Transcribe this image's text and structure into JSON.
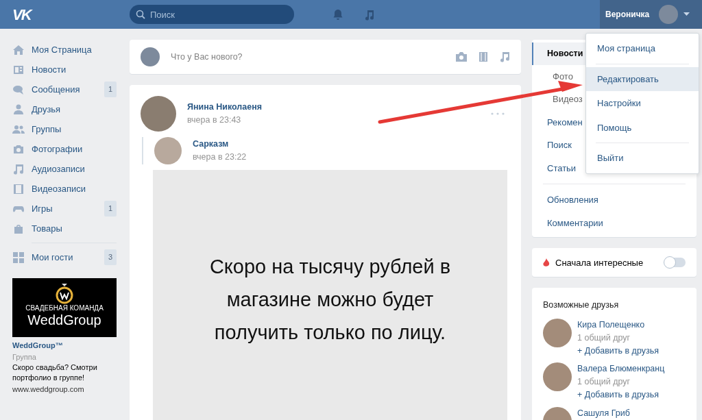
{
  "header": {
    "logo": "VK",
    "search_placeholder": "Поиск",
    "user_name": "Вероничка"
  },
  "sidebar": {
    "items": [
      {
        "label": "Моя Страница"
      },
      {
        "label": "Новости"
      },
      {
        "label": "Сообщения",
        "badge": "1"
      },
      {
        "label": "Друзья"
      },
      {
        "label": "Группы"
      },
      {
        "label": "Фотографии"
      },
      {
        "label": "Аудиозаписи"
      },
      {
        "label": "Видеозаписи"
      },
      {
        "label": "Игры",
        "badge": "1"
      },
      {
        "label": "Товары"
      }
    ],
    "extra_items": [
      {
        "label": "Мои гости",
        "badge": "3"
      }
    ],
    "ad": {
      "logo_caption": "СВАДЕБНАЯ КОМАНДА",
      "logo_name": "WeddGroup",
      "title": "WeddGroup™",
      "type": "Группа",
      "text": "Скоро свадьба? Смотри портфолио в группе!",
      "url": "www.weddgroup.com"
    }
  },
  "composer": {
    "placeholder": "Что у Вас нового?"
  },
  "post": {
    "author": "Янина Николаеня",
    "time": "вчера в 23:43",
    "repost": {
      "author": "Сарказм",
      "time": "вчера в 23:22"
    },
    "image_text": "Скоро на тысячу рублей в магазине можно будет получить только по лицу."
  },
  "news_nav": {
    "groups": [
      [
        {
          "label": "Новости",
          "kind": "main",
          "selected": true
        },
        {
          "label": "Фото",
          "kind": "sub",
          "selected": false
        },
        {
          "label": "Видеоз",
          "kind": "sub",
          "selected": false
        },
        {
          "label": "Рекомен",
          "kind": "main",
          "selected": false
        },
        {
          "label": "Поиск",
          "kind": "main",
          "selected": false
        },
        {
          "label": "Статьи",
          "kind": "main",
          "selected": false
        }
      ],
      [
        {
          "label": "Обновления",
          "kind": "main",
          "selected": false
        },
        {
          "label": "Комментарии",
          "kind": "main",
          "selected": false
        }
      ]
    ]
  },
  "interesting_toggle": {
    "label": "Сначала интересные",
    "on": false
  },
  "possible_friends": {
    "title": "Возможные друзья",
    "people": [
      {
        "name": "Кира Полещенко",
        "mutual": "1 общий друг",
        "action": "+ Добавить в друзья"
      },
      {
        "name": "Валера Блюменкранц",
        "mutual": "1 общий друг",
        "action": "+ Добавить в друзья"
      },
      {
        "name": "Сашуля Гриб"
      }
    ]
  },
  "profile_menu": {
    "groups": [
      [
        {
          "label": "Моя страница",
          "selected": false
        }
      ],
      [
        {
          "label": "Редактировать",
          "selected": true
        },
        {
          "label": "Настройки",
          "selected": false
        },
        {
          "label": "Помощь",
          "selected": false
        }
      ],
      [
        {
          "label": "Выйти",
          "selected": false
        }
      ]
    ]
  }
}
